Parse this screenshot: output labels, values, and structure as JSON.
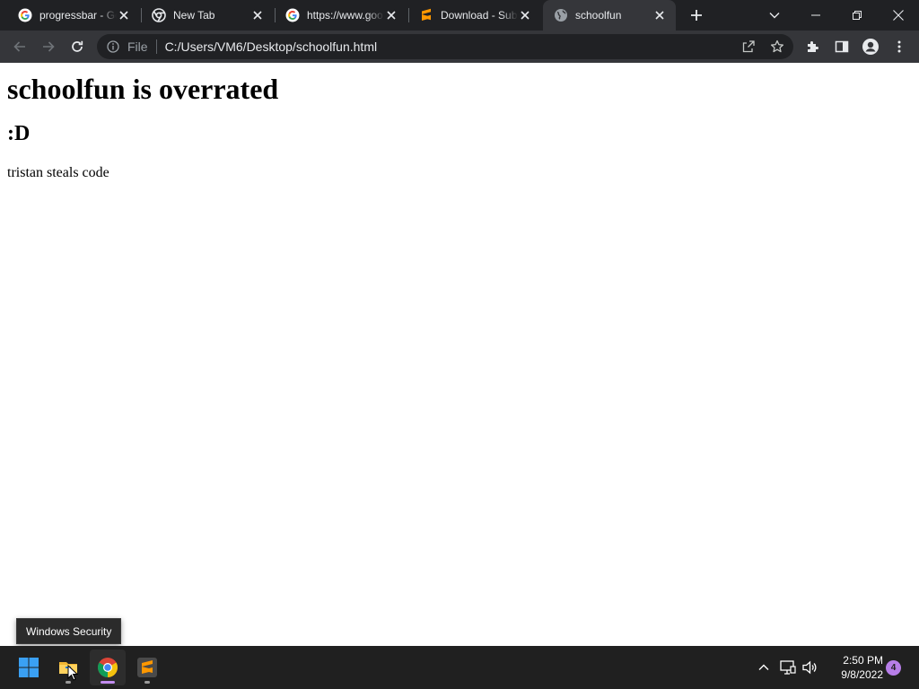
{
  "browser": {
    "tabs": [
      {
        "title": "progressbar - Goo",
        "icon": "google-g-icon",
        "active": false
      },
      {
        "title": "New Tab",
        "icon": "chrome-icon",
        "active": false
      },
      {
        "title": "https://www.goo",
        "icon": "google-g-icon",
        "active": false
      },
      {
        "title": "Download - Subl",
        "icon": "sublime-text-icon",
        "active": false
      },
      {
        "title": "schoolfun",
        "icon": "globe-icon",
        "active": true
      }
    ],
    "address_bar": {
      "scheme_label": "File",
      "url": "C:/Users/VM6/Desktop/schoolfun.html"
    }
  },
  "page": {
    "heading1": "schoolfun is overrated",
    "heading2": ":D",
    "paragraph": "tristan steals code"
  },
  "tooltip": {
    "text": "Windows Security"
  },
  "taskbar": {
    "apps": [
      {
        "name": "start-button",
        "icon": "windows-logo-icon"
      },
      {
        "name": "file-explorer",
        "icon": "folder-icon"
      },
      {
        "name": "google-chrome",
        "icon": "chrome-icon"
      },
      {
        "name": "sublime-text",
        "icon": "sublime-text-icon"
      }
    ],
    "clock": {
      "time": "2:50 PM",
      "date": "9/8/2022"
    },
    "notification_count": "4"
  },
  "colors": {
    "tabstrip_bg": "#202124",
    "toolbar_bg": "#35363a",
    "omnibox_bg": "#202124",
    "taskbar_bg": "#202020",
    "accent_purple": "#b77ee8"
  }
}
